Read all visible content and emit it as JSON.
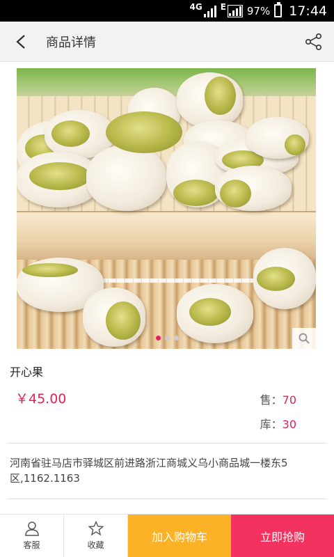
{
  "status_bar": {
    "network": "4G",
    "data_type": "E",
    "battery": "97%",
    "time": "17:44"
  },
  "header": {
    "back_icon": "chevron-left-icon",
    "title": "商品详情",
    "share_icon": "share-icon"
  },
  "gallery": {
    "image_subject": "pistachios on bamboo mat",
    "zoom_icon": "search-icon",
    "pages": 3,
    "active_page": 1
  },
  "product": {
    "name": "开心果",
    "price": "￥45.00",
    "sold_label": "售：",
    "sold_value": "70",
    "stock_label": "库：",
    "stock_value": "30",
    "address": "河南省驻马店市驿城区前进路浙江商城义乌小商品城一楼东5区,1162.1163"
  },
  "bottom_bar": {
    "service_label": "客服",
    "service_icon": "person-icon",
    "favorite_label": "收藏",
    "favorite_icon": "star-icon",
    "add_to_cart_label": "加入购物车",
    "buy_now_label": "立即抢购"
  },
  "colors": {
    "accent": "#e6205a",
    "cart_button": "#fbb226",
    "buy_button": "#f4325f"
  }
}
